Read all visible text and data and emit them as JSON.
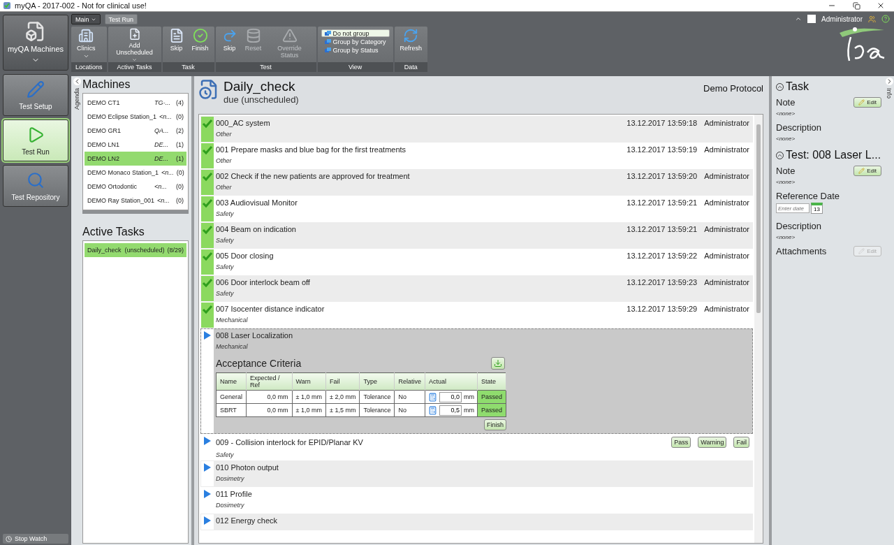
{
  "window": {
    "title": "myQA - 2017-002 - Not for clinical use!"
  },
  "launcher": {
    "label": "myQA Machines"
  },
  "nav": [
    {
      "label": "Test Setup",
      "selected": false
    },
    {
      "label": "Test Run",
      "selected": true
    },
    {
      "label": "Test Repository",
      "selected": false
    }
  ],
  "stop_watch": "Stop Watch",
  "ribbon_tabs": [
    {
      "label": "Main",
      "kind": "menu"
    },
    {
      "label": "Test Run",
      "kind": "tab"
    }
  ],
  "ribbon_groups": [
    {
      "label": "Locations",
      "kind": "buttons",
      "buttons": [
        {
          "label": "Clinics",
          "dropdown": true,
          "disabled": false
        }
      ]
    },
    {
      "label": "Active Tasks",
      "kind": "buttons",
      "buttons": [
        {
          "label": "Add Unscheduled",
          "dropdown": true,
          "disabled": false
        }
      ]
    },
    {
      "label": "Task",
      "kind": "buttons",
      "buttons": [
        {
          "label": "Skip",
          "dropdown": false,
          "disabled": false
        },
        {
          "label": "Finish",
          "dropdown": false,
          "disabled": false
        }
      ]
    },
    {
      "label": "Test",
      "kind": "buttons",
      "buttons": [
        {
          "label": "Skip",
          "dropdown": false,
          "disabled": false
        },
        {
          "label": "Reset",
          "dropdown": false,
          "disabled": true
        },
        {
          "label": "Override Status",
          "dropdown": false,
          "disabled": true
        }
      ]
    },
    {
      "label": "View",
      "kind": "options",
      "options": [
        {
          "label": "Do not group",
          "selected": true
        },
        {
          "label": "Group by Category",
          "selected": false
        },
        {
          "label": "Group by Status",
          "selected": false
        }
      ]
    },
    {
      "label": "Data",
      "kind": "buttons",
      "buttons": [
        {
          "label": "Refresh",
          "dropdown": false,
          "disabled": false
        }
      ]
    }
  ],
  "user": {
    "name": "Administrator"
  },
  "agenda_tab": "Agenda",
  "machines": {
    "title": "Machines",
    "items": [
      {
        "name": "DEMO CT1",
        "info": "TG-...",
        "count": "(4)",
        "selected": false
      },
      {
        "name": "DEMO Eclipse Station_1",
        "info": "<n...",
        "count": "(0)",
        "selected": false
      },
      {
        "name": "DEMO GR1",
        "info": "QA...",
        "count": "(2)",
        "selected": false
      },
      {
        "name": "DEMO LN1",
        "info": "DE...",
        "count": "(1)",
        "selected": false
      },
      {
        "name": "DEMO LN2",
        "info": "DE...",
        "count": "(1)",
        "selected": true
      },
      {
        "name": "DEMO Monaco Station_1",
        "info": "<n...",
        "count": "(0)",
        "selected": false
      },
      {
        "name": "DEMO Ortodontic",
        "info": "<n...",
        "count": "(0)",
        "selected": false
      },
      {
        "name": "DEMO Ray Station_001",
        "info": "<n...",
        "count": "(0)",
        "selected": false
      }
    ]
  },
  "active_tasks": {
    "title": "Active Tasks",
    "items": [
      {
        "name": "Daily_check",
        "note": "(unscheduled)",
        "count": "(8/29)",
        "selected": true
      }
    ]
  },
  "task": {
    "title": "Daily_check",
    "subtitle": "due (unscheduled)",
    "protocol": "Demo Protocol",
    "tests": [
      {
        "title": "000_AC system",
        "category": "Other",
        "done": true,
        "date": "13.12.2017 13:59:18",
        "user": "Administrator",
        "expanded": false
      },
      {
        "title": "001 Prepare masks and blue bag for the first treatments",
        "category": "Other",
        "done": true,
        "date": "13.12.2017 13:59:19",
        "user": "Administrator",
        "expanded": false
      },
      {
        "title": "002 Check if the new patients are approved for treatment",
        "category": "Other",
        "done": true,
        "date": "13.12.2017 13:59:20",
        "user": "Administrator",
        "expanded": false
      },
      {
        "title": "003 Audiovisual Monitor",
        "category": "Safety",
        "done": true,
        "date": "13.12.2017 13:59:21",
        "user": "Administrator",
        "expanded": false
      },
      {
        "title": "004 Beam on indication",
        "category": "Safety",
        "done": true,
        "date": "13.12.2017 13:59:21",
        "user": "Administrator",
        "expanded": false
      },
      {
        "title": "005 Door closing",
        "category": "Safety",
        "done": true,
        "date": "13.12.2017 13:59:22",
        "user": "Administrator",
        "expanded": false
      },
      {
        "title": "006 Door interlock beam off",
        "category": "Safety",
        "done": true,
        "date": "13.12.2017 13:59:23",
        "user": "Administrator",
        "expanded": false
      },
      {
        "title": "007 Isocenter distance indicator",
        "category": "Mechanical",
        "done": true,
        "date": "13.12.2017 13:59:29",
        "user": "Administrator",
        "expanded": false
      },
      {
        "title": "008 Laser Localization",
        "category": "Mechanical",
        "done": false,
        "expanded": true,
        "criteria": {
          "title": "Acceptance Criteria",
          "columns": [
            "Name",
            "Expected / Ref",
            "Warn",
            "Fail",
            "Type",
            "Relative",
            "Actual",
            "State"
          ],
          "rows": [
            {
              "name": "General",
              "expected": "0,0 mm",
              "warn": "± 1,0 mm",
              "fail": "± 2,0 mm",
              "type": "Tolerance",
              "relative": "No",
              "actual": "0,0",
              "unit": "mm",
              "state": "Passed"
            },
            {
              "name": "SBRT",
              "expected": "0,0 mm",
              "warn": "± 1,0 mm",
              "fail": "± 1,5 mm",
              "type": "Tolerance",
              "relative": "No",
              "actual": "0,5",
              "unit": "mm",
              "state": "Passed"
            }
          ],
          "finish": "Finish"
        }
      },
      {
        "title": "009 - Collision interlock for EPID/Planar KV",
        "category": "Safety",
        "done": false,
        "expanded": false,
        "actions": [
          "Pass",
          "Warning",
          "Fail"
        ]
      },
      {
        "title": "010 Photon output",
        "category": "Dosimetry",
        "done": false,
        "expanded": false
      },
      {
        "title": "011 Profile",
        "category": "Dosimetry",
        "done": false,
        "expanded": false
      },
      {
        "title": "012 Energy check",
        "done": false,
        "expanded": false
      }
    ]
  },
  "info": {
    "tab": "Info",
    "sections": [
      {
        "title": "Task",
        "expanded": true,
        "fields": [
          {
            "kind": "edit",
            "label": "Note",
            "value": "<none>",
            "action": "Edit",
            "disabled": false
          },
          {
            "kind": "text",
            "label": "Description",
            "value": "<none>"
          }
        ]
      },
      {
        "title": "Test: 008 Laser L...",
        "expanded": true,
        "fields": [
          {
            "kind": "edit",
            "label": "Note",
            "value": "<none>",
            "action": "Edit",
            "disabled": false
          },
          {
            "kind": "date",
            "label": "Reference Date",
            "placeholder": "Enter date",
            "day": "13"
          },
          {
            "kind": "text",
            "label": "Description",
            "value": "<none>"
          },
          {
            "kind": "edit",
            "label": "Attachments",
            "action": "Edit",
            "disabled": true
          }
        ]
      }
    ]
  }
}
